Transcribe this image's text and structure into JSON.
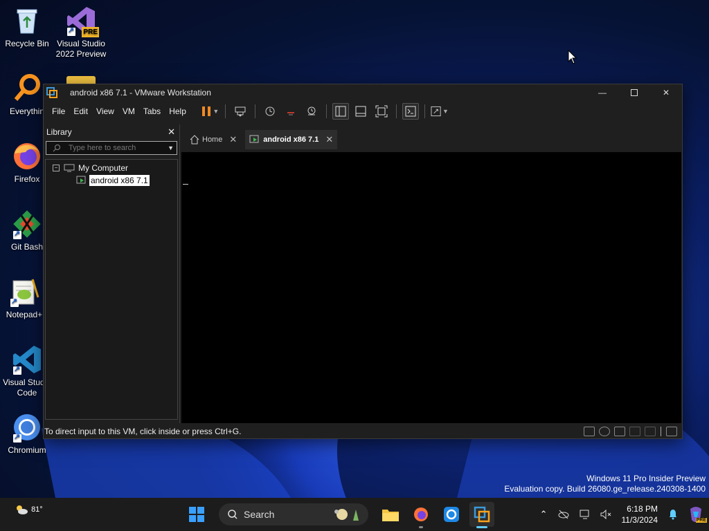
{
  "desktop": {
    "icons": [
      {
        "label": "Recycle Bin"
      },
      {
        "label": "Visual Studio 2022 Preview"
      },
      {
        "label": "Everythin"
      },
      {
        "label": "Firefox"
      },
      {
        "label": "Git Bash"
      },
      {
        "label": "Notepad+"
      },
      {
        "label": "Visual Studio Code"
      },
      {
        "label": "Chromium"
      }
    ],
    "vs_badge": "PRE"
  },
  "window": {
    "title": "android x86 7.1 - VMware Workstation",
    "menu": [
      "File",
      "Edit",
      "View",
      "VM",
      "Tabs",
      "Help"
    ],
    "library": {
      "title": "Library",
      "search_placeholder": "Type here to search",
      "root": "My Computer",
      "vm": "android x86 7.1"
    },
    "tabs": [
      {
        "label": "Home"
      },
      {
        "label": "android x86 7.1"
      }
    ],
    "status_message": "To direct input to this VM, click inside or press Ctrl+G."
  },
  "watermark": {
    "line1": "Windows 11 Pro Insider Preview",
    "line2": "Evaluation copy. Build 26080.ge_release.240308-1400"
  },
  "taskbar": {
    "weather_temp": "81°",
    "search_label": "Search",
    "time": "6:18 PM",
    "date": "11/3/2024",
    "copilot_badge": "PRE"
  }
}
